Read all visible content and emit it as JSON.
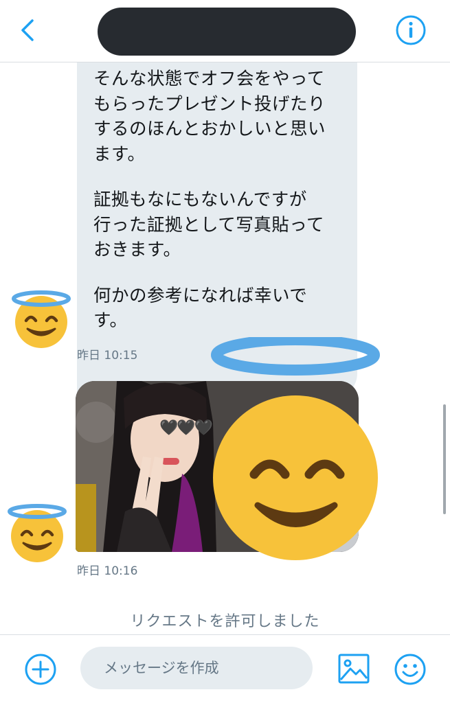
{
  "header": {
    "back_icon": "chevron-left-icon",
    "info_icon": "info-icon",
    "title_redacted": true
  },
  "conversation": {
    "message_lines": [
      "そんな状態でオフ会をやって",
      "もらったプレゼント投げたり",
      "するのほんとおかしいと思い",
      "ます。",
      "",
      "証拠もなにもないんですが",
      "行った証拠として写真貼って",
      "おきます。",
      "",
      "何かの参考になれば幸いで",
      "す。"
    ],
    "message_timestamp": "昨日 10:15",
    "photo_timestamp": "昨日 10:16",
    "photo_overlay": "🖤🖤🖤",
    "system_message": "リクエストを許可しました"
  },
  "composer": {
    "placeholder": "メッセージを作成",
    "value": "",
    "add_icon": "plus-circle-icon",
    "image_icon": "image-icon",
    "emoji_icon": "smiley-icon"
  },
  "colors": {
    "accent": "#1da1f2",
    "bubble": "#e6ecf0",
    "secondary_text": "#657786",
    "redaction": "#272b30",
    "halo": "#5aa9e6",
    "emoji_face": "#f7c23a"
  }
}
